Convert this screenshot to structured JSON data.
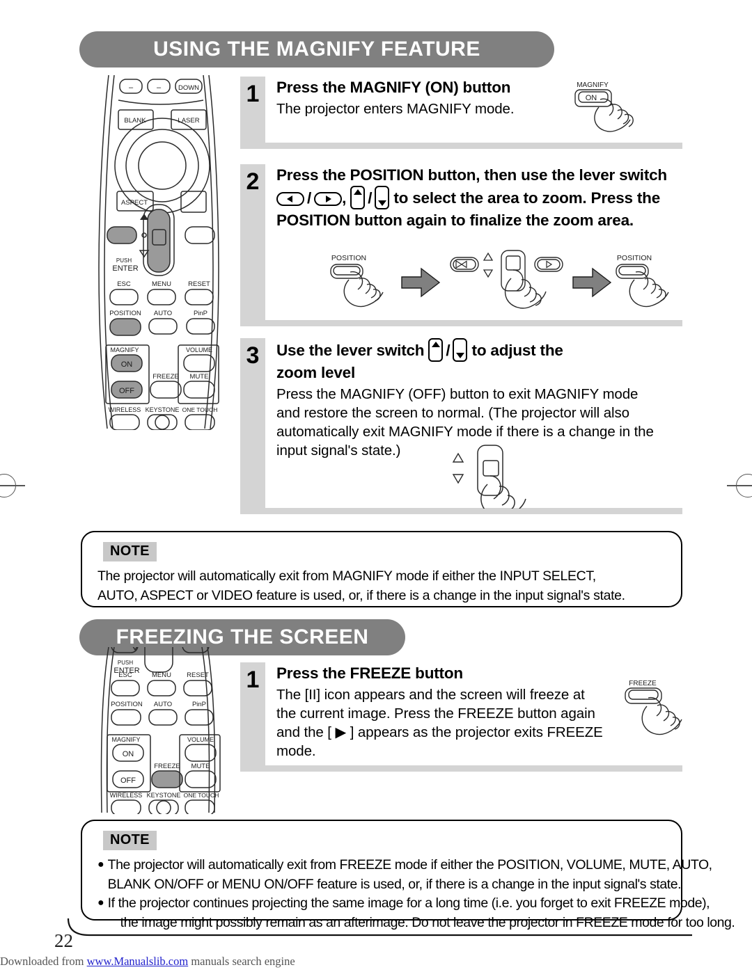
{
  "document": {
    "page_number": "22",
    "footer": {
      "prefix": "Downloaded from",
      "link": "www.Manualslib.com",
      "suffix": "manuals search engine"
    },
    "colors": {
      "banner_gray": "#808080",
      "step_column_gray": "#d4d4d4",
      "note_label_gray": "#c8c8c8",
      "arrow_gray": "#808080",
      "highlight_button_gray": "#a0a0a0",
      "link_blue": "#2222cc"
    }
  },
  "sections": [
    {
      "id": "magnify",
      "banner_title": "USING THE MAGNIFY FEATURE",
      "steps": [
        {
          "number": "1",
          "title": "Press the MAGNIFY (ON) button",
          "description": "The projector enters MAGNIFY mode.",
          "callout_button": {
            "label_top": "MAGNIFY",
            "label_key": "ON"
          }
        },
        {
          "number": "2",
          "title_line1": "Press the POSITION button, then use the lever switch",
          "title_line2_pre": "",
          "title_line2_post": "to select the area to zoom. Press the",
          "title_line3": "POSITION button again to finalize the zoom area.",
          "diagram": {
            "step_a_label": "POSITION",
            "step_b_left_glyph": "left-arrow-button",
            "step_b_up_glyph": "up-triangle",
            "step_b_down_glyph": "down-triangle",
            "step_b_right_glyph": "right-arrow-button",
            "step_c_label": "POSITION"
          }
        },
        {
          "number": "3",
          "title_pre": "Use the lever switch",
          "title_post": "to adjust the",
          "title_line2": "zoom level",
          "description": "Press the MAGNIFY (OFF) button to exit MAGNIFY mode and restore the screen to normal. (The projector will also automatically exit MAGNIFY mode if there is a change in the input signal's state.)",
          "desc_lines": [
            "Press the MAGNIFY (OFF) button to exit MAGNIFY mode",
            "and restore the screen to normal. (The projector will also",
            "automatically exit MAGNIFY mode if there is a change in the",
            "input signal's state.)"
          ]
        }
      ],
      "note": {
        "label": "NOTE",
        "lines": [
          "The projector will automatically exit from MAGNIFY mode if either the INPUT SELECT,",
          "AUTO, ASPECT or VIDEO feature is used, or, if there is a change in the input signal's state."
        ]
      }
    },
    {
      "id": "freeze",
      "banner_title": "FREEZING THE SCREEN",
      "steps": [
        {
          "number": "1",
          "title": "Press the FREEZE button",
          "desc_lines": [
            "The [II] icon appears and the screen will freeze at",
            "the current image. Press the FREEZE button again",
            "and the [ ▶ ] appears as the projector exits FREEZE",
            "mode."
          ],
          "callout_button": {
            "label_top": "FREEZE",
            "label_key": ""
          }
        }
      ],
      "note": {
        "label": "NOTE",
        "bullets": [
          [
            "The projector will automatically exit from FREEZE mode if either the POSITION, VOLUME, MUTE, AUTO,",
            "BLANK ON/OFF or MENU ON/OFF feature is used, or, if there is a change in the input signal's state."
          ],
          [
            "If the projector continues projecting the same image for a long time (i.e. you forget to exit FREEZE mode),",
            "the image might possibly remain as an afterimage. Do not leave the projector in FREEZE mode for too long."
          ]
        ]
      }
    }
  ],
  "remote_top": {
    "row_top": [
      "–",
      "–",
      "DOWN"
    ],
    "blank": "BLANK",
    "laser": "LASER",
    "aspect": "ASPECT",
    "push_enter": [
      "PUSH",
      "ENTER"
    ],
    "rows": [
      [
        "ESC",
        "MENU",
        "RESET"
      ],
      [
        "POSITION",
        "AUTO",
        "PinP"
      ]
    ],
    "magnify_group": {
      "label": "MAGNIFY",
      "on": "ON",
      "off": "OFF"
    },
    "freeze": "FREEZE",
    "volume_group": {
      "volume": "VOLUME",
      "mute": "MUTE"
    },
    "bottom_row": [
      "WIRELESS",
      "KEYSTONE",
      "ONE TOUCH"
    ],
    "highlighted": [
      "POSITION",
      "MAGNIFY ON",
      "MAGNIFY OFF",
      "lever-switch"
    ]
  },
  "remote_bottom": {
    "push_enter": [
      "PUSH",
      "ENTER"
    ],
    "rows": [
      [
        "ESC",
        "MENU",
        "RESET"
      ],
      [
        "POSITION",
        "AUTO",
        "PinP"
      ]
    ],
    "magnify_group": {
      "label": "MAGNIFY",
      "on": "ON",
      "off": "OFF"
    },
    "freeze": "FREEZE",
    "volume_group": {
      "volume": "VOLUME",
      "mute": "MUTE"
    },
    "bottom_row": [
      "WIRELESS",
      "KEYSTONE",
      "ONE TOUCH"
    ],
    "highlighted": [
      "FREEZE"
    ]
  }
}
